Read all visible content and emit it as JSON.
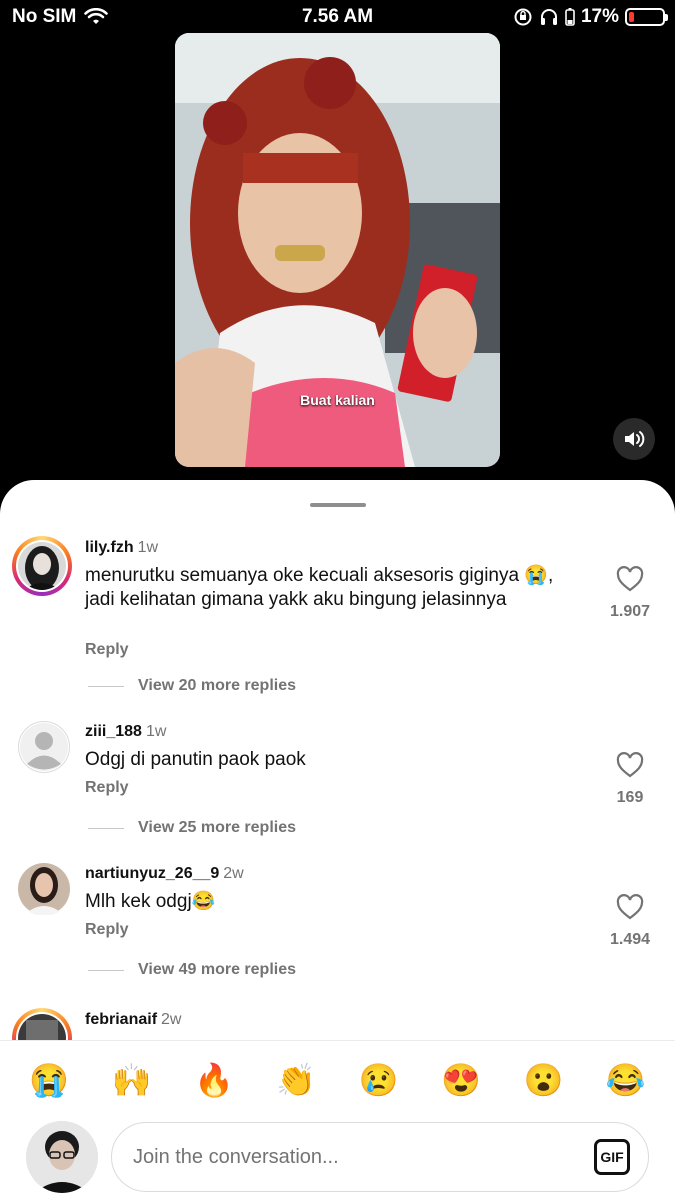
{
  "status": {
    "carrier": "No SIM",
    "time": "7.56 AM",
    "battery": "17%"
  },
  "video": {
    "caption": "Buat kalian"
  },
  "comments": [
    {
      "username": "lily.fzh",
      "ago": "1w",
      "text": "menurutku semuanya oke kecuali aksesoris giginya 😭, jadi kelihatan gimana yakk aku bingung jelasinnya",
      "reply": "Reply",
      "likes": "1.907",
      "view_more": "View 20 more replies"
    },
    {
      "username": "ziii_188",
      "ago": "1w",
      "text": "Odgj di panutin paok paok",
      "reply": "Reply",
      "likes": "169",
      "view_more": "View 25 more replies"
    },
    {
      "username": "nartiunyuz_26__9",
      "ago": "2w",
      "text": "Mlh kek odgj😂",
      "reply": "Reply",
      "likes": "1.494",
      "view_more": "View 49 more replies"
    },
    {
      "username": "febrianaif",
      "ago": "2w"
    }
  ],
  "emojis": [
    "😭",
    "🙌",
    "🔥",
    "👏",
    "😢",
    "😍",
    "😮",
    "😂"
  ],
  "composer": {
    "placeholder": "Join the conversation...",
    "gif_label": "GIF"
  },
  "colors": {
    "sheet": "#ffffff",
    "muted": "#737373",
    "battery_low": "#ff3b30"
  }
}
